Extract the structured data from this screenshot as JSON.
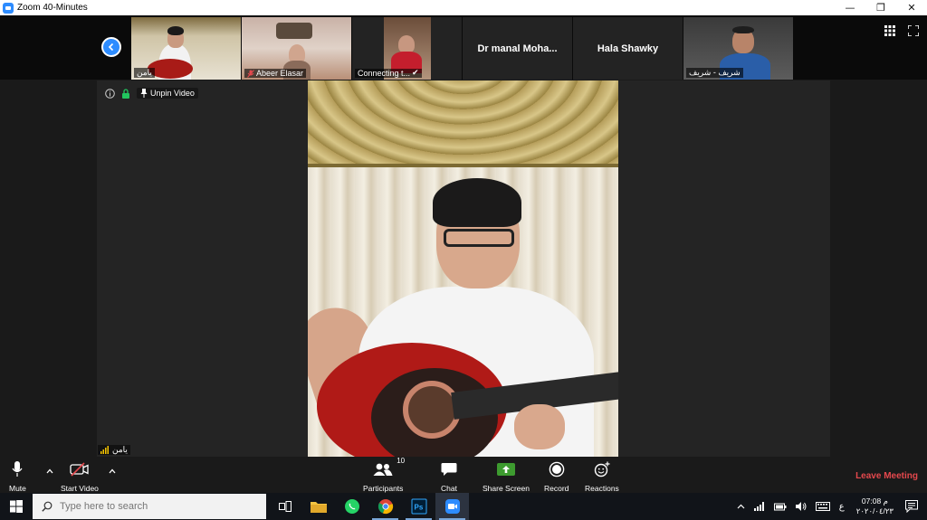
{
  "window": {
    "title": "Zoom 40-Minutes",
    "controls": [
      "minimize-icon",
      "restore-icon",
      "close-icon"
    ]
  },
  "gallery_strip": {
    "thumbnails": [
      {
        "name": "يامن",
        "has_video": true,
        "active": true
      },
      {
        "name": "Abeer Elasar",
        "has_video": true,
        "muted": true
      },
      {
        "name": "Connecting t...",
        "has_video": true,
        "status": "check-icon"
      },
      {
        "name": "Dr manal Moha...",
        "has_video": false
      },
      {
        "name": "Hala Shawky",
        "has_video": false
      },
      {
        "name": "شريف - شريف",
        "has_video": true
      }
    ],
    "right_icons": [
      "gallery-view-icon",
      "fullscreen-icon"
    ]
  },
  "stage": {
    "unpin_label": "Unpin Video",
    "speaker_name": "يامن",
    "icons": [
      "info-icon",
      "lock-icon",
      "pin-icon"
    ]
  },
  "toolbar": {
    "mute": "Mute",
    "start_video": "Start Video",
    "participants": "Participants",
    "participants_count": "10",
    "chat": "Chat",
    "share_screen": "Share Screen",
    "record": "Record",
    "reactions": "Reactions",
    "leave": "Leave Meeting",
    "colors": {
      "leave": "#e5484d",
      "share": "#3d9b2f",
      "accent": "#2d8cff"
    }
  },
  "taskbar": {
    "search_placeholder": "Type here to search",
    "apps": [
      "task-view-icon",
      "file-explorer-icon",
      "whatsapp-icon",
      "chrome-icon",
      "photoshop-icon",
      "zoom-icon"
    ],
    "language": "ع",
    "time": "07:08 م",
    "date": "٢٠٢٠/٠٤/٢٣"
  }
}
